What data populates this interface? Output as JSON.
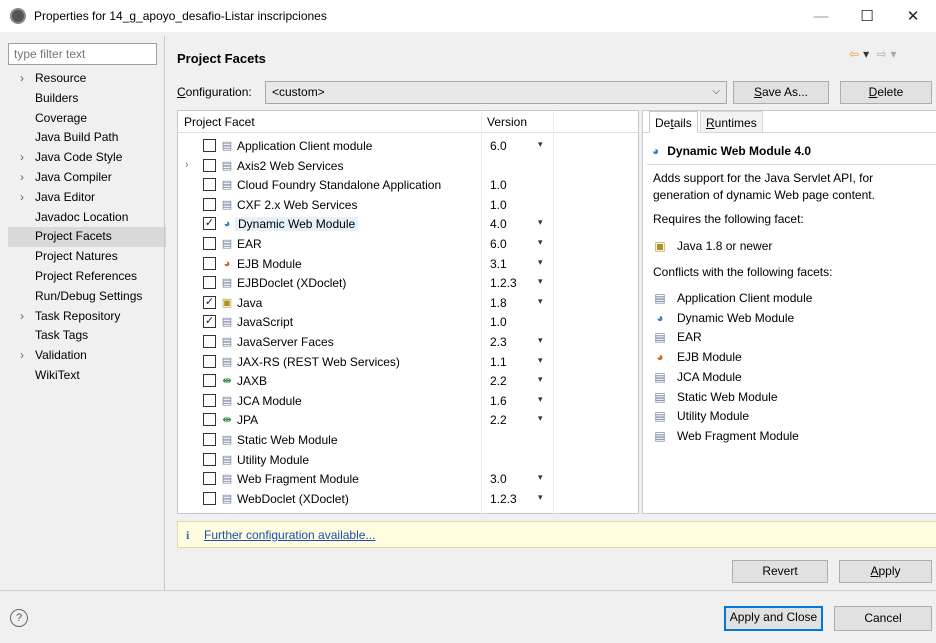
{
  "window": {
    "title": "Properties for 14_g_apoyo_desafio-Listar inscripciones",
    "minimize_glyph": "—",
    "maximize_glyph": "☐",
    "close_glyph": "✕"
  },
  "sidebar": {
    "filter_placeholder": "type filter text",
    "items": [
      {
        "label": "Resource",
        "expandable": true,
        "selected": false
      },
      {
        "label": "Builders",
        "expandable": false,
        "selected": false
      },
      {
        "label": "Coverage",
        "expandable": false,
        "selected": false
      },
      {
        "label": "Java Build Path",
        "expandable": false,
        "selected": false
      },
      {
        "label": "Java Code Style",
        "expandable": true,
        "selected": false
      },
      {
        "label": "Java Compiler",
        "expandable": true,
        "selected": false
      },
      {
        "label": "Java Editor",
        "expandable": true,
        "selected": false
      },
      {
        "label": "Javadoc Location",
        "expandable": false,
        "selected": false
      },
      {
        "label": "Project Facets",
        "expandable": false,
        "selected": true
      },
      {
        "label": "Project Natures",
        "expandable": false,
        "selected": false
      },
      {
        "label": "Project References",
        "expandable": false,
        "selected": false
      },
      {
        "label": "Run/Debug Settings",
        "expandable": false,
        "selected": false
      },
      {
        "label": "Task Repository",
        "expandable": true,
        "selected": false
      },
      {
        "label": "Task Tags",
        "expandable": false,
        "selected": false
      },
      {
        "label": "Validation",
        "expandable": true,
        "selected": false
      },
      {
        "label": "WikiText",
        "expandable": false,
        "selected": false
      }
    ]
  },
  "page": {
    "title": "Project Facets",
    "configuration_label_mnemonic": "C",
    "configuration_label_rest": "onfiguration:",
    "configuration_value": "<custom>",
    "save_as_mnemonic": "S",
    "save_as_rest": "ave As...",
    "delete_mnemonic": "D",
    "delete_rest": "elete"
  },
  "facets": {
    "col_facet": "Project Facet",
    "col_version": "Version",
    "rows": [
      {
        "name": "Application Client module",
        "version": "6.0",
        "checked": false,
        "dropdown": true,
        "icon": "doc-icon",
        "expandable": false,
        "highlight": false
      },
      {
        "name": "Axis2 Web Services",
        "version": "",
        "checked": false,
        "dropdown": false,
        "icon": "doc-icon",
        "expandable": true,
        "highlight": false
      },
      {
        "name": "Cloud Foundry Standalone Application",
        "version": "1.0",
        "checked": false,
        "dropdown": false,
        "icon": "doc-icon",
        "expandable": false,
        "highlight": false
      },
      {
        "name": "CXF 2.x Web Services",
        "version": "1.0",
        "checked": false,
        "dropdown": false,
        "icon": "doc-icon",
        "expandable": false,
        "highlight": false
      },
      {
        "name": "Dynamic Web Module",
        "version": "4.0",
        "checked": true,
        "dropdown": true,
        "icon": "web-module-icon",
        "expandable": false,
        "highlight": true
      },
      {
        "name": "EAR",
        "version": "6.0",
        "checked": false,
        "dropdown": true,
        "icon": "doc-icon",
        "expandable": false,
        "highlight": false
      },
      {
        "name": "EJB Module",
        "version": "3.1",
        "checked": false,
        "dropdown": true,
        "icon": "ejb-icon",
        "expandable": false,
        "highlight": false
      },
      {
        "name": "EJBDoclet (XDoclet)",
        "version": "1.2.3",
        "checked": false,
        "dropdown": true,
        "icon": "doc-icon",
        "expandable": false,
        "highlight": false
      },
      {
        "name": "Java",
        "version": "1.8",
        "checked": true,
        "dropdown": true,
        "icon": "java-icon",
        "expandable": false,
        "highlight": false
      },
      {
        "name": "JavaScript",
        "version": "1.0",
        "checked": true,
        "dropdown": false,
        "icon": "doc-icon",
        "expandable": false,
        "highlight": false
      },
      {
        "name": "JavaServer Faces",
        "version": "2.3",
        "checked": false,
        "dropdown": true,
        "icon": "doc-icon",
        "expandable": false,
        "highlight": false
      },
      {
        "name": "JAX-RS (REST Web Services)",
        "version": "1.1",
        "checked": false,
        "dropdown": true,
        "icon": "doc-icon",
        "expandable": false,
        "highlight": false
      },
      {
        "name": "JAXB",
        "version": "2.2",
        "checked": false,
        "dropdown": true,
        "icon": "jaxb-icon",
        "expandable": false,
        "highlight": false
      },
      {
        "name": "JCA Module",
        "version": "1.6",
        "checked": false,
        "dropdown": true,
        "icon": "doc-icon",
        "expandable": false,
        "highlight": false
      },
      {
        "name": "JPA",
        "version": "2.2",
        "checked": false,
        "dropdown": true,
        "icon": "jaxb-icon",
        "expandable": false,
        "highlight": false
      },
      {
        "name": "Static Web Module",
        "version": "",
        "checked": false,
        "dropdown": false,
        "icon": "doc-icon",
        "expandable": false,
        "highlight": false
      },
      {
        "name": "Utility Module",
        "version": "",
        "checked": false,
        "dropdown": false,
        "icon": "doc-icon",
        "expandable": false,
        "highlight": false
      },
      {
        "name": "Web Fragment Module",
        "version": "3.0",
        "checked": false,
        "dropdown": true,
        "icon": "doc-icon",
        "expandable": false,
        "highlight": false
      },
      {
        "name": "WebDoclet (XDoclet)",
        "version": "1.2.3",
        "checked": false,
        "dropdown": true,
        "icon": "doc-icon",
        "expandable": false,
        "highlight": false
      }
    ]
  },
  "details": {
    "tab_details_pre": "De",
    "tab_details_mnemonic": "t",
    "tab_details_post": "ails",
    "tab_runtimes_mnemonic": "R",
    "tab_runtimes_rest": "untimes",
    "title": "Dynamic Web Module 4.0",
    "description": "Adds support for the Java Servlet API, for generation of dynamic Web page content.",
    "requires_label": "Requires the following facet:",
    "requires": [
      {
        "label": "Java 1.8 or newer",
        "icon": "java-icon"
      }
    ],
    "conflicts_label": "Conflicts with the following facets:",
    "conflicts": [
      {
        "label": "Application Client module",
        "icon": "doc-icon"
      },
      {
        "label": "Dynamic Web Module",
        "icon": "web-module-icon"
      },
      {
        "label": "EAR",
        "icon": "doc-icon"
      },
      {
        "label": "EJB Module",
        "icon": "ejb-icon"
      },
      {
        "label": "JCA Module",
        "icon": "doc-icon"
      },
      {
        "label": "Static Web Module",
        "icon": "doc-icon"
      },
      {
        "label": "Utility Module",
        "icon": "doc-icon"
      },
      {
        "label": "Web Fragment Module",
        "icon": "doc-icon"
      }
    ]
  },
  "infobar": {
    "link": "Further configuration available..."
  },
  "buttons": {
    "revert": "Revert",
    "apply_mnemonic": "A",
    "apply_rest": "pply",
    "apply_and_close": "Apply and Close",
    "cancel": "Cancel"
  },
  "colors": {
    "accent": "#0078d7",
    "selection": "#d9d9d9",
    "link": "#1a4fb0",
    "info_bg": "#fffce0"
  }
}
